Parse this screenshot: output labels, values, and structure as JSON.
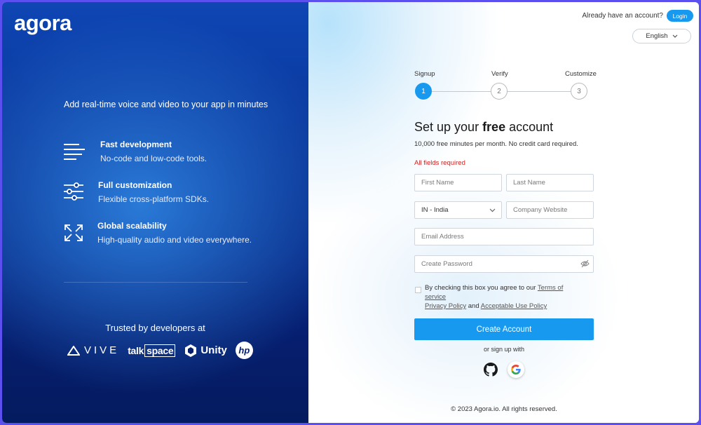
{
  "brand": {
    "logo_text": "agora"
  },
  "left": {
    "tagline": "Add real-time voice and video to your app in minutes",
    "features": [
      {
        "title": "Fast development",
        "desc": "No-code and low-code tools.",
        "icon": "lines-icon"
      },
      {
        "title": "Full customization",
        "desc": "Flexible cross-platform SDKs.",
        "icon": "sliders-icon"
      },
      {
        "title": "Global scalability",
        "desc": "High-quality audio and video everywhere.",
        "icon": "expand-arrows-icon"
      }
    ],
    "trusted": "Trusted by developers at",
    "partners": {
      "vive": "VIVE",
      "talk": "talk",
      "space": "space",
      "unity": "Unity",
      "hp": "hp"
    }
  },
  "header": {
    "have_account": "Already have an account?",
    "login": "Login",
    "language": "English"
  },
  "steps": [
    {
      "label": "Signup",
      "number": "1"
    },
    {
      "label": "Verify",
      "number": "2"
    },
    {
      "label": "Customize",
      "number": "3"
    }
  ],
  "form": {
    "heading_prefix": "Set up your ",
    "heading_bold": "free",
    "heading_suffix": " account",
    "subheading": "10,000 free minutes per month. No credit card required.",
    "required_note": "All fields required",
    "first_name_placeholder": "First Name",
    "last_name_placeholder": "Last Name",
    "country_value": "IN - India",
    "company_placeholder": "Company Website",
    "email_placeholder": "Email Address",
    "password_placeholder": "Create Password",
    "consent_text": "By checking this box you agree to our ",
    "terms_link": "Terms of service",
    "privacy_link": "Privacy Policy",
    "and_text": " and ",
    "aup_link": "Acceptable Use Policy",
    "create_button": "Create Account",
    "or_text": "or sign up with"
  },
  "footer": {
    "copyright": "© 2023 Agora.io. All rights reserved."
  },
  "colors": {
    "accent": "#1899f0",
    "left_bg": "#0a3598",
    "error": "#d32020",
    "frame": "#5b4ff0"
  }
}
